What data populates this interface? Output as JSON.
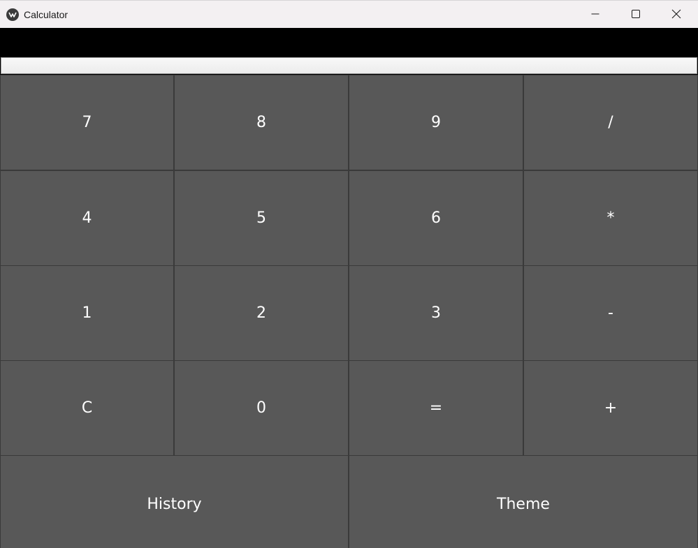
{
  "window": {
    "title": "Calculator",
    "controls": {
      "minimize_icon": "minimize-icon",
      "maximize_icon": "maximize-icon",
      "close_icon": "close-icon"
    }
  },
  "display": {
    "result": "",
    "input_value": ""
  },
  "keypad": {
    "rows": [
      [
        "7",
        "8",
        "9",
        "/"
      ],
      [
        "4",
        "5",
        "6",
        "*"
      ],
      [
        "1",
        "2",
        "3",
        "-"
      ],
      [
        "C",
        "0",
        "=",
        "+"
      ]
    ],
    "history_label": "History",
    "theme_label": "Theme"
  },
  "colors": {
    "key_background": "#585858",
    "key_text": "#ffffff",
    "display_background": "#000000",
    "titlebar_background": "#f3f0f2"
  }
}
